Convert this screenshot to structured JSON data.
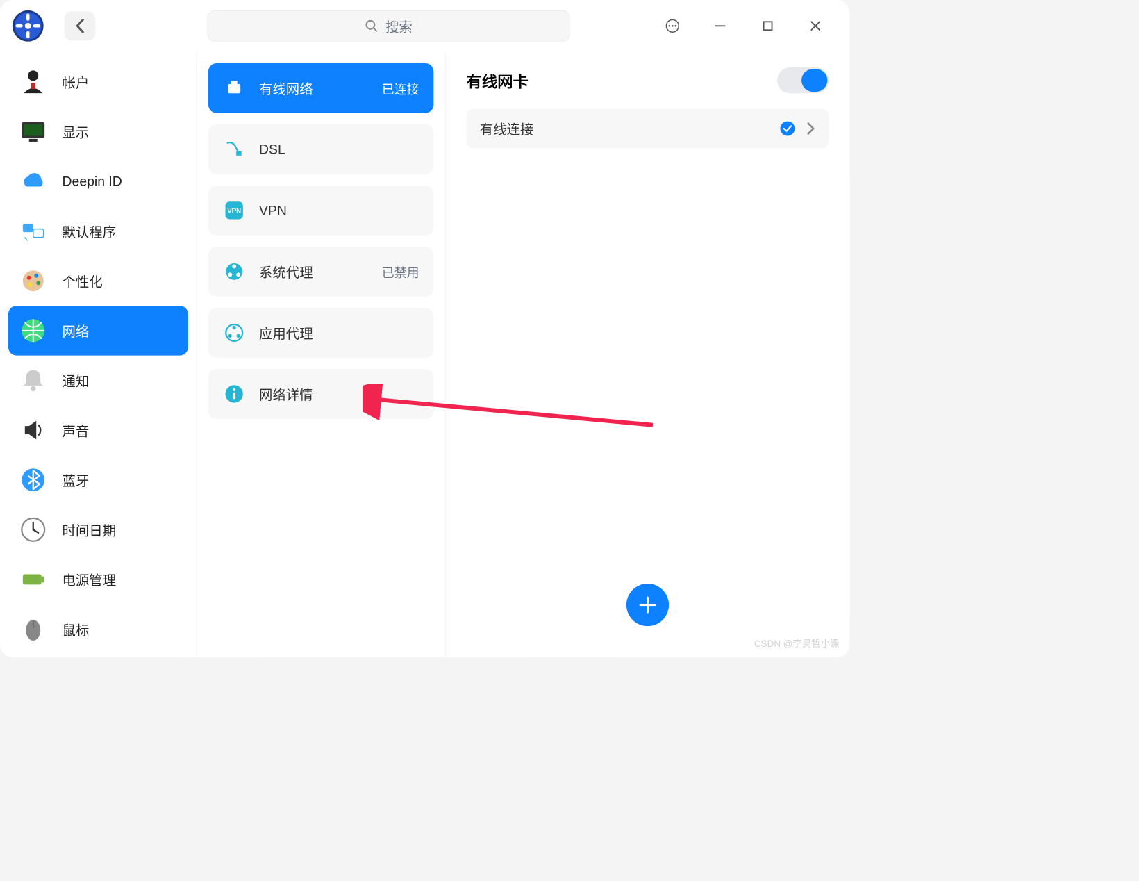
{
  "titlebar": {
    "search_placeholder": "搜索"
  },
  "sidebar": {
    "items": [
      {
        "label": "帐户",
        "icon": "user"
      },
      {
        "label": "显示",
        "icon": "display"
      },
      {
        "label": "Deepin ID",
        "icon": "cloud"
      },
      {
        "label": "默认程序",
        "icon": "apps"
      },
      {
        "label": "个性化",
        "icon": "palette"
      },
      {
        "label": "网络",
        "icon": "network",
        "active": true
      },
      {
        "label": "通知",
        "icon": "bell"
      },
      {
        "label": "声音",
        "icon": "speaker"
      },
      {
        "label": "蓝牙",
        "icon": "bluetooth"
      },
      {
        "label": "时间日期",
        "icon": "clock"
      },
      {
        "label": "电源管理",
        "icon": "battery"
      },
      {
        "label": "鼠标",
        "icon": "mouse"
      }
    ]
  },
  "network_categories": [
    {
      "label": "有线网络",
      "status": "已连接",
      "icon": "ethernet",
      "active": true
    },
    {
      "label": "DSL",
      "status": "",
      "icon": "dsl"
    },
    {
      "label": "VPN",
      "status": "",
      "icon": "vpn"
    },
    {
      "label": "系统代理",
      "status": "已禁用",
      "icon": "proxy"
    },
    {
      "label": "应用代理",
      "status": "",
      "icon": "app-proxy"
    },
    {
      "label": "网络详情",
      "status": "",
      "icon": "info"
    }
  ],
  "detail": {
    "title": "有线网卡",
    "connection_label": "有线连接",
    "toggle_on": true
  },
  "watermark": "CSDN @李昊哲小课"
}
